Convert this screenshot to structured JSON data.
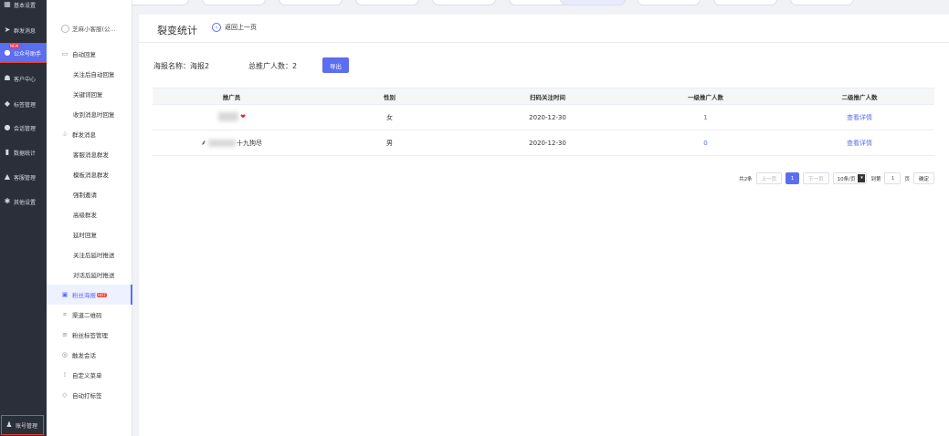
{
  "nav": {
    "items": [
      {
        "label": "基本设置",
        "icon": "grid-icon"
      },
      {
        "label": "群发消息",
        "icon": "send-icon"
      },
      {
        "label": "公众号助手",
        "icon": "wechat-icon"
      },
      {
        "label": "客户中心",
        "icon": "users-icon"
      },
      {
        "label": "标签管理",
        "icon": "tag-icon"
      },
      {
        "label": "会话管理",
        "icon": "chat-icon"
      },
      {
        "label": "数据统计",
        "icon": "bar-chart-icon"
      },
      {
        "label": "客服管理",
        "icon": "headset-icon"
      },
      {
        "label": "其他设置",
        "icon": "gear-icon"
      }
    ],
    "active_badge": "NEW",
    "account": "账号管理"
  },
  "subnav": {
    "account_name": "芝麻小客服(公...",
    "items": [
      {
        "label": "自动回复",
        "level": 1,
        "icon": "message-icon"
      },
      {
        "label": "关注后自动回复",
        "level": 2
      },
      {
        "label": "关键词回复",
        "level": 2
      },
      {
        "label": "收到消息时回复",
        "level": 2
      },
      {
        "label": "群发消息",
        "level": 1,
        "icon": "group-icon"
      },
      {
        "label": "客服消息群发",
        "level": 2
      },
      {
        "label": "模板消息群发",
        "level": 2
      },
      {
        "label": "强制邀请",
        "level": 2
      },
      {
        "label": "高级群发",
        "level": 2
      },
      {
        "label": "延时回复",
        "level": 2
      },
      {
        "label": "关注后延时推送",
        "level": 2
      },
      {
        "label": "对话后延时推送",
        "level": 2
      },
      {
        "label": "粉丝海报",
        "level": 1,
        "icon": "poster-icon",
        "active": true,
        "badge": "HOT"
      },
      {
        "label": "渠道二维码",
        "level": 1,
        "icon": "qrcode-icon"
      },
      {
        "label": "粉丝标签管理",
        "level": 1,
        "icon": "list-icon"
      },
      {
        "label": "触发会话",
        "level": 1,
        "icon": "wifi-icon"
      },
      {
        "label": "自定义菜单",
        "level": 1,
        "icon": "menu-icon"
      },
      {
        "label": "自动打标签",
        "level": 1,
        "icon": "tag-outline-icon"
      }
    ]
  },
  "main": {
    "title": "裂变统计",
    "back_label": "返回上一页",
    "poster_label": "海报名称：",
    "poster_name": "海报2",
    "total_label": "总推广人数：",
    "total_value": "2",
    "export_label": "导出",
    "columns": [
      "推广员",
      "性别",
      "扫码关注时间",
      "一级推广人数",
      "二级推广人数"
    ],
    "rows": [
      {
        "promoter": "",
        "gender": "女",
        "time": "2020-12-30",
        "level1": "1",
        "level2": "查看详情"
      },
      {
        "promoter": "十九狗尽",
        "gender": "男",
        "time": "2020-12-30",
        "level1": "0",
        "level2": "查看详情"
      }
    ]
  },
  "pagination": {
    "total": "共2条",
    "prev": "上一页",
    "current": "1",
    "next": "下一页",
    "page_size": "10条/页",
    "goto_label": "到第",
    "goto_value": "1",
    "page_unit": "页",
    "confirm": "确定"
  },
  "colors": {
    "accent": "#5b6ef0",
    "nav_bg": "#2b2f3a",
    "highlight": "#e0453b"
  }
}
